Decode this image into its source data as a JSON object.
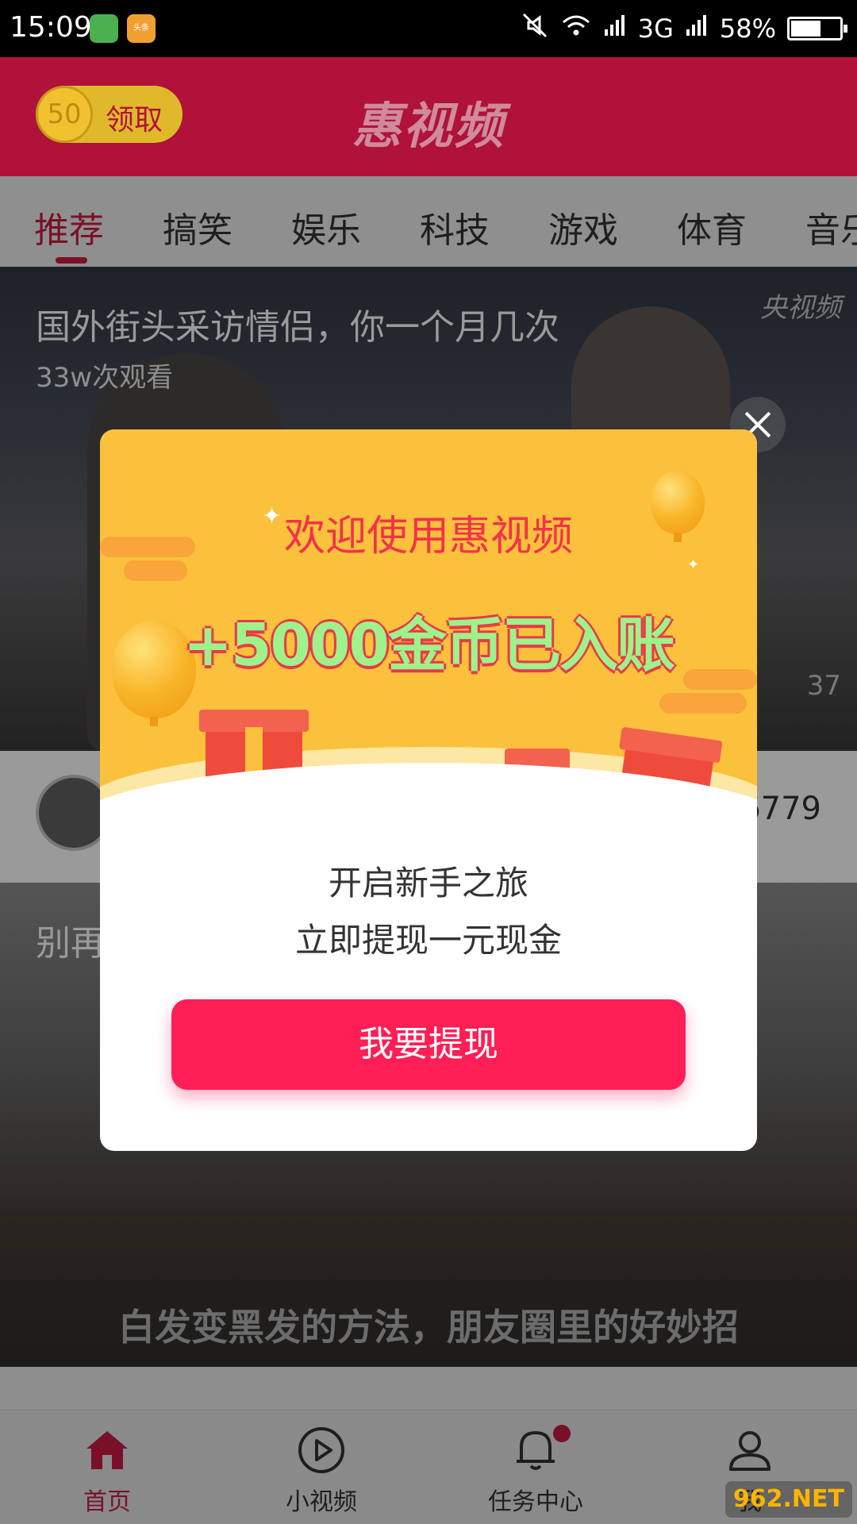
{
  "status_bar": {
    "time": "15:09",
    "network": "3G",
    "battery": "58%",
    "app_icon_label": "头条"
  },
  "header": {
    "coin_amount": "50",
    "coin_action": "领取",
    "title": "惠视频"
  },
  "tabs": [
    "推荐",
    "搞笑",
    "娱乐",
    "科技",
    "游戏",
    "体育",
    "音乐"
  ],
  "feed": {
    "item1": {
      "title": "国外街头采访情侣，你一个月几次",
      "views": "33w次观看",
      "watermark": "央视频",
      "duration": "37",
      "count": "6779"
    },
    "item2": {
      "title": "别再",
      "caption": "白发变黑发的方法，朋友圈里的好妙招"
    }
  },
  "modal": {
    "title": "欢迎使用惠视频",
    "reward": "+5000金币已入账",
    "coin_symbol": "¥",
    "line1": "开启新手之旅",
    "line2": "立即提现一元现金",
    "button": "我要提现"
  },
  "bottom_nav": [
    {
      "label": "首页",
      "icon": "home-icon"
    },
    {
      "label": "小视频",
      "icon": "play-icon"
    },
    {
      "label": "任务中心",
      "icon": "bell-icon"
    },
    {
      "label": "我",
      "icon": "user-icon"
    }
  ],
  "watermark_site": "962.NET"
}
